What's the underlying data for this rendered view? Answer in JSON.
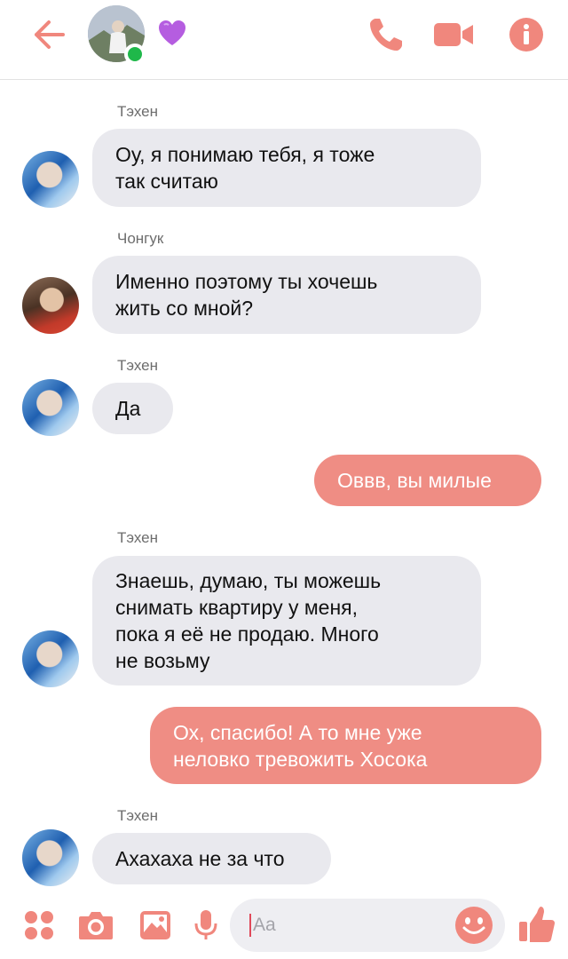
{
  "header": {
    "back_icon": "arrow-left-icon",
    "status": "online",
    "emoji": "purple-heart",
    "call_icon": "phone-icon",
    "video_icon": "video-camera-icon",
    "info_icon": "info-icon",
    "accent": "#f0877d"
  },
  "messages": [
    {
      "sender": "Тэхен",
      "text_lines": [
        "Оу, я понимаю тебя, я тоже",
        "так считаю"
      ],
      "direction": "in"
    },
    {
      "sender": "Чонгук",
      "text_lines": [
        "Именно поэтому ты хочешь",
        "жить со мной?"
      ],
      "direction": "in"
    },
    {
      "sender": "Тэхен",
      "text_lines": [
        "Да"
      ],
      "direction": "in"
    },
    {
      "text_lines": [
        "Оввв, вы милые"
      ],
      "direction": "out"
    },
    {
      "sender": "Тэхен",
      "text_lines": [
        "Знаешь, думаю, ты можешь",
        "снимать квартиру у меня,",
        "пока я её не продаю. Много",
        "не возьму"
      ],
      "direction": "in"
    },
    {
      "text_lines": [
        "Ох, спасибо! А то мне уже",
        "неловко тревожить Хосока"
      ],
      "direction": "out"
    },
    {
      "sender": "Тэхен",
      "text_lines": [
        "Ахахаха не за что"
      ],
      "direction": "in"
    }
  ],
  "composer": {
    "placeholder": "Aa",
    "icons": [
      "apps-icon",
      "camera-icon",
      "image-icon",
      "mic-icon",
      "emoji-icon",
      "thumbs-up-icon"
    ]
  },
  "colors": {
    "incoming_bubble": "#e9e9ee",
    "outgoing_bubble": "#ef8d84",
    "online": "#1fb84a"
  }
}
